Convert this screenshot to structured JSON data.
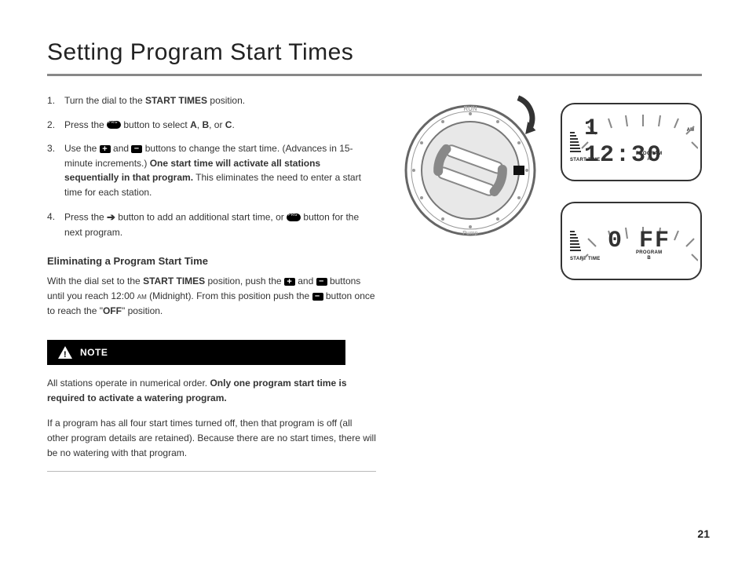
{
  "title": "Setting Program Start Times",
  "steps": {
    "s1a": "Turn the dial to the ",
    "s1b": "START TIMES",
    "s1c": " position.",
    "s2a": "Press the ",
    "s2b": " button to select ",
    "s2c": "A",
    "s2d": ", ",
    "s2e": "B",
    "s2f": ", or ",
    "s2g": "C",
    "s2h": ".",
    "s3a": "Use the ",
    "s3b": " and ",
    "s3c": " buttons to change the start time. (Advances in 15-minute increments.) ",
    "s3d": "One start time will activate all stations sequentially in that program.",
    "s3e": " This eliminates the need to enter a start time for each station.",
    "s4a": "Press the ",
    "s4b": " button to add an additional start time, or ",
    "s4c": " button for the next program."
  },
  "elim_head": "Eliminating a Program Start Time",
  "elim_a": "With the dial set to the ",
  "elim_b": "START TIMES",
  "elim_c": " position, push the ",
  "elim_d": " and ",
  "elim_e": " buttons until you reach 12:00 ",
  "elim_f": "am",
  "elim_g": " (Midnight). From this position push the ",
  "elim_h": " button once to reach the \"",
  "elim_i": "OFF",
  "elim_j": "\" position.",
  "note_label": "NOTE",
  "note1a": "All stations operate in numerical order. ",
  "note1b": "Only one program start time is required to activate a watering program.",
  "note2": "If a program has all four start times turned off, then that program is off (all other program details are retained). Because there are no start times, there will be no watering with that program.",
  "dial_top": "RUN",
  "dial_bottom": "Pump",
  "lcd1": {
    "digits": "1 12:30",
    "start": "START TIME",
    "prog": "PROGRAM",
    "letter": "A",
    "ampm": "AM"
  },
  "lcd2": {
    "digits": "0 FF",
    "start": "START TIME",
    "prog": "PROGRAM",
    "letter": "B"
  },
  "page": "21"
}
